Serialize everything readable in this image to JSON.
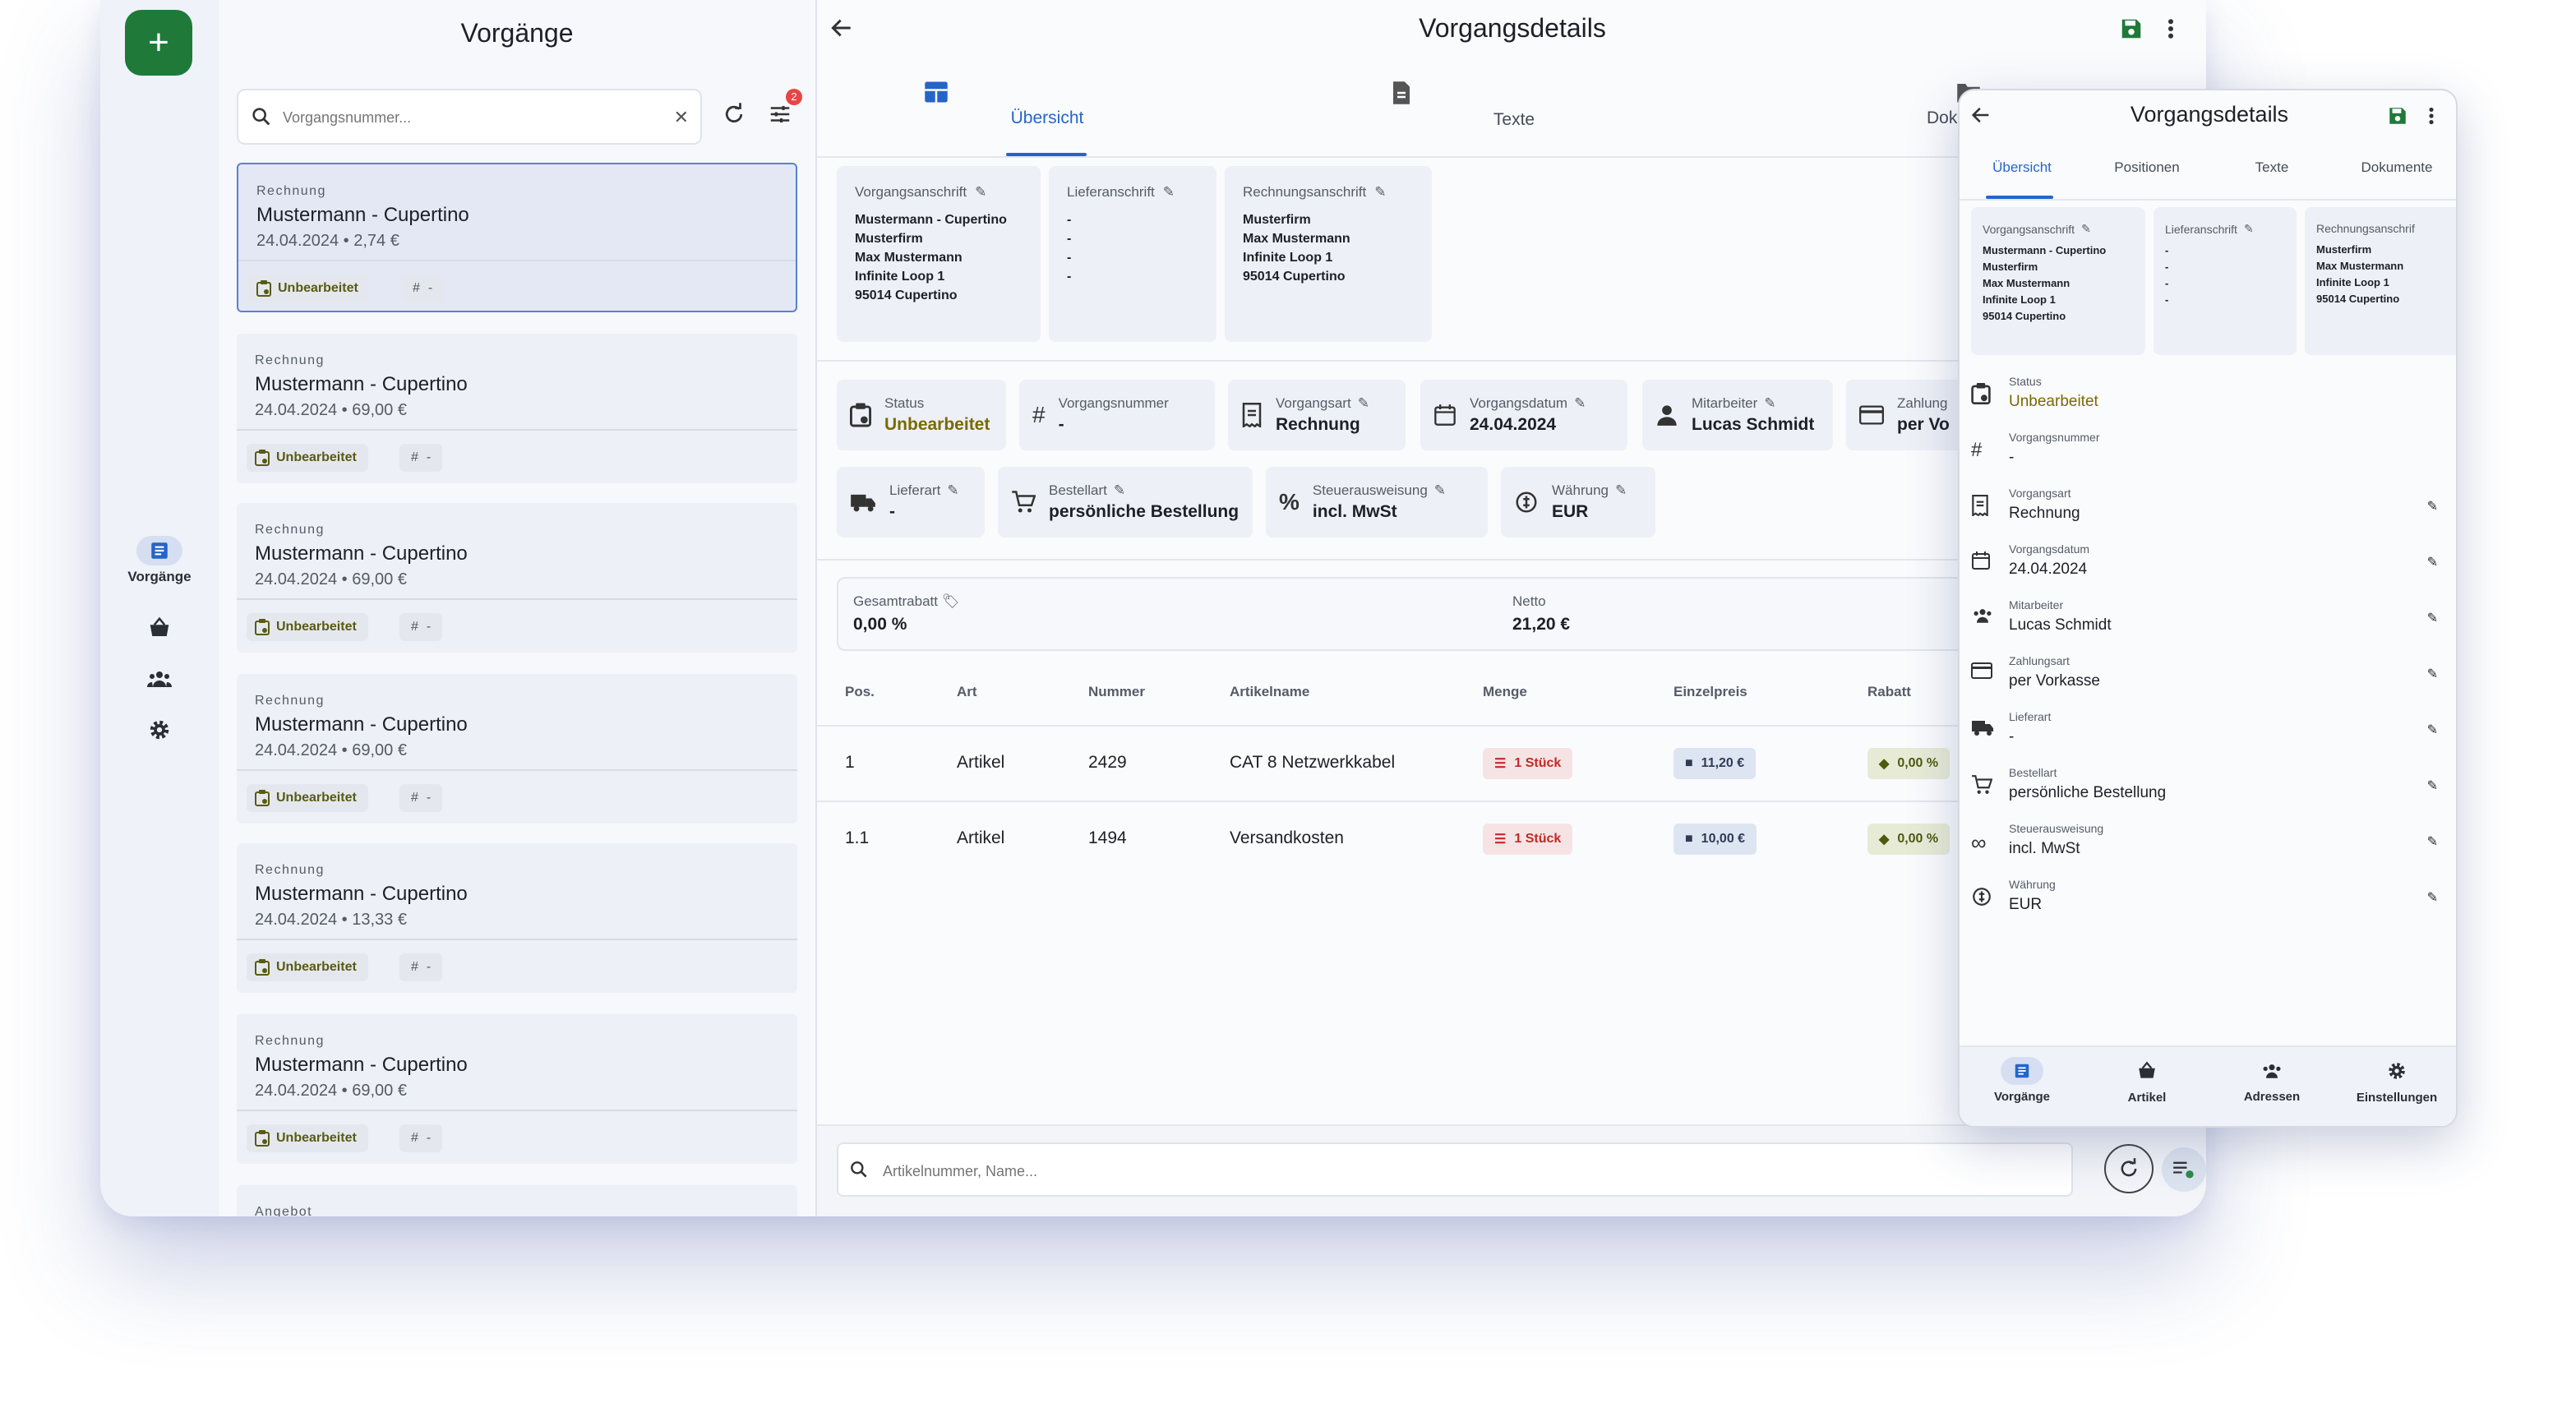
{
  "rail": {
    "items": [
      {
        "label": "Vorgänge",
        "icon": "list-icon",
        "active": true
      },
      {
        "label": "",
        "icon": "basket-icon"
      },
      {
        "label": "",
        "icon": "people-icon"
      },
      {
        "label": "",
        "icon": "gear-icon"
      }
    ]
  },
  "list": {
    "title": "Vorgänge",
    "search_placeholder": "Vorgangsnummer...",
    "filter_badge": "2",
    "cards": [
      {
        "type": "Rechnung",
        "name": "Mustermann - Cupertino",
        "sub": "24.04.2024 • 2,74 €",
        "status": "Unbearbeitet",
        "number": "-"
      },
      {
        "type": "Rechnung",
        "name": "Mustermann - Cupertino",
        "sub": "24.04.2024 • 69,00 €",
        "status": "Unbearbeitet",
        "number": "-"
      },
      {
        "type": "Rechnung",
        "name": "Mustermann - Cupertino",
        "sub": "24.04.2024 • 69,00 €",
        "status": "Unbearbeitet",
        "number": "-"
      },
      {
        "type": "Rechnung",
        "name": "Mustermann - Cupertino",
        "sub": "24.04.2024 • 69,00 €",
        "status": "Unbearbeitet",
        "number": "-"
      },
      {
        "type": "Rechnung",
        "name": "Mustermann - Cupertino",
        "sub": "24.04.2024 • 13,33 €",
        "status": "Unbearbeitet",
        "number": "-"
      },
      {
        "type": "Rechnung",
        "name": "Mustermann - Cupertino",
        "sub": "24.04.2024 • 69,00 €",
        "status": "Unbearbeitet",
        "number": "-"
      },
      {
        "type": "Angebot"
      }
    ]
  },
  "detail": {
    "title": "Vorgangsdetails",
    "tabs": [
      "Übersicht",
      "Texte",
      "Dok"
    ],
    "addresses": [
      {
        "title": "Vorgangsanschrift",
        "lines": [
          "Mustermann - Cupertino",
          "Musterfirm",
          "Max Mustermann",
          "Infinite Loop 1",
          "95014 Cupertino"
        ]
      },
      {
        "title": "Lieferanschrift",
        "lines": [
          "-",
          "-",
          "-",
          "-"
        ]
      },
      {
        "title": "Rechnungsanschrift",
        "lines": [
          "Musterfirm",
          "Max Mustermann",
          "Infinite Loop 1",
          "95014 Cupertino"
        ]
      }
    ],
    "chips": [
      {
        "label": "Status",
        "value": "Unbearbeitet",
        "icon": "clipboard-icon"
      },
      {
        "label": "Vorgangsnummer",
        "value": "-",
        "icon": "hash-icon"
      },
      {
        "label": "Vorgangsart",
        "value": "Rechnung",
        "icon": "receipt-icon"
      },
      {
        "label": "Vorgangsdatum",
        "value": "24.04.2024",
        "icon": "calendar-icon"
      },
      {
        "label": "Mitarbeiter",
        "value": "Lucas Schmidt",
        "icon": "person-icon"
      },
      {
        "label": "Zahlung",
        "value": "per Vo",
        "icon": "card-icon"
      },
      {
        "label": "Lieferart",
        "value": "-",
        "icon": "truck-icon"
      },
      {
        "label": "Bestellart",
        "value": "persönliche Bestellung",
        "icon": "cart-icon"
      },
      {
        "label": "Steuerausweisung",
        "value": "incl. MwSt",
        "icon": "percent-icon"
      },
      {
        "label": "Währung",
        "value": "EUR",
        "icon": "currency-icon"
      }
    ],
    "discount_label": "Gesamtrabatt",
    "discount_value": "0,00 %",
    "net_label": "Netto",
    "net_value": "21,20 €",
    "columns": [
      "Pos.",
      "Art",
      "Nummer",
      "Artikelname",
      "Menge",
      "Einzelpreis",
      "Rabatt"
    ],
    "rows": [
      {
        "pos": "1",
        "art": "Artikel",
        "nummer": "2429",
        "name": "CAT 8 Netzwerkkabel",
        "menge": "1 Stück",
        "preis": "11,20 €",
        "rabatt": "0,00 %"
      },
      {
        "pos": "1.1",
        "art": "Artikel",
        "nummer": "1494",
        "name": "Versandkosten",
        "menge": "1 Stück",
        "preis": "10,00 €",
        "rabatt": "0,00 %"
      }
    ],
    "article_search_placeholder": "Artikelnummer, Name..."
  },
  "phone": {
    "title": "Vorgangsdetails",
    "tabs": [
      "Übersicht",
      "Positionen",
      "Texte",
      "Dokumente"
    ],
    "addresses": [
      {
        "title": "Vorgangsanschrift",
        "lines": [
          "Mustermann - Cupertino",
          "Musterfirm",
          "Max Mustermann",
          "Infinite Loop 1",
          "95014 Cupertino"
        ]
      },
      {
        "title": "Lieferanschrift",
        "lines": [
          "-",
          "-",
          "-",
          "-"
        ]
      },
      {
        "title": "Rechnungsanschrif",
        "lines": [
          "Musterfirm",
          "Max Mustermann",
          "Infinite Loop 1",
          "95014 Cupertino"
        ]
      }
    ],
    "rows": [
      {
        "label": "Status",
        "value": "Unbearbeitet",
        "icon": "clipboard-icon"
      },
      {
        "label": "Vorgangsnummer",
        "value": "-",
        "icon": "hash-icon"
      },
      {
        "label": "Vorgangsart",
        "value": "Rechnung",
        "icon": "receipt-icon"
      },
      {
        "label": "Vorgangsdatum",
        "value": "24.04.2024",
        "icon": "calendar-icon"
      },
      {
        "label": "Mitarbeiter",
        "value": "Lucas Schmidt",
        "icon": "people-icon"
      },
      {
        "label": "Zahlungsart",
        "value": "per Vorkasse",
        "icon": "card-icon"
      },
      {
        "label": "Lieferart",
        "value": "-",
        "icon": "truck-icon"
      },
      {
        "label": "Bestellart",
        "value": "persönliche Bestellung",
        "icon": "cart-icon"
      },
      {
        "label": "Steuerausweisung",
        "value": "incl. MwSt",
        "icon": "infinity-icon"
      },
      {
        "label": "Währung",
        "value": "EUR",
        "icon": "currency-icon"
      }
    ],
    "nav": [
      "Vorgänge",
      "Artikel",
      "Adressen",
      "Einstellungen"
    ]
  },
  "colors": {
    "accent": "#2565c9",
    "fab": "#1f7a3a",
    "status": "#7a6a00",
    "badge": "#e84545"
  }
}
